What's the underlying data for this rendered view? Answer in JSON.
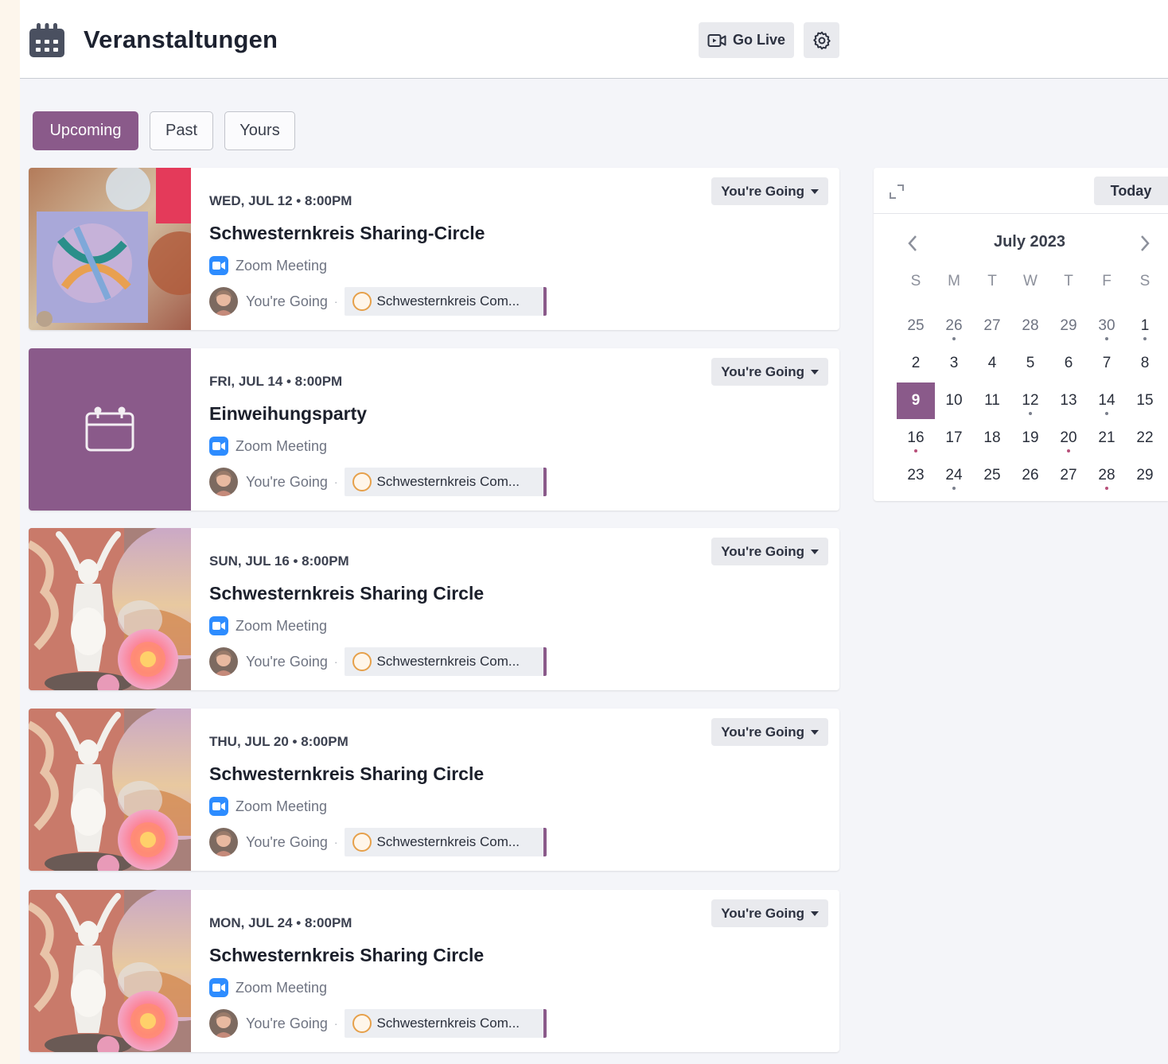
{
  "header": {
    "title": "Veranstaltungen",
    "go_live_label": "Go Live",
    "icons": {
      "page": "calendar-icon",
      "go_live": "video-icon",
      "settings": "gear-icon"
    }
  },
  "tabs": [
    {
      "label": "Upcoming",
      "active": true
    },
    {
      "label": "Past",
      "active": false
    },
    {
      "label": "Yours",
      "active": false
    }
  ],
  "events": [
    {
      "date": "WED, JUL 12 • 8:00PM",
      "title": "Schwesternkreis Sharing-Circle",
      "location": "Zoom Meeting",
      "attendance": "You're Going",
      "community": "Schwesternkreis Com...",
      "rsvp": "You're Going",
      "thumb": "painting-circle"
    },
    {
      "date": "FRI, JUL 14 • 8:00PM",
      "title": "Einweihungsparty",
      "location": "Zoom Meeting",
      "attendance": "You're Going",
      "community": "Schwesternkreis Com...",
      "rsvp": "You're Going",
      "thumb": "placeholder-calendar"
    },
    {
      "date": "SUN, JUL 16 • 8:00PM",
      "title": "Schwesternkreis Sharing Circle",
      "location": "Zoom Meeting",
      "attendance": "You're Going",
      "community": "Schwesternkreis Com...",
      "rsvp": "You're Going",
      "thumb": "goddess-rose"
    },
    {
      "date": "THU, JUL 20 • 8:00PM",
      "title": "Schwesternkreis Sharing Circle",
      "location": "Zoom Meeting",
      "attendance": "You're Going",
      "community": "Schwesternkreis Com...",
      "rsvp": "You're Going",
      "thumb": "goddess-rose"
    },
    {
      "date": "MON, JUL 24 • 8:00PM",
      "title": "Schwesternkreis Sharing Circle",
      "location": "Zoom Meeting",
      "attendance": "You're Going",
      "community": "Schwesternkreis Com...",
      "rsvp": "You're Going",
      "thumb": "goddess-rose"
    }
  ],
  "calendar": {
    "today_label": "Today",
    "month_label": "July 2023",
    "weekdays": [
      "S",
      "M",
      "T",
      "W",
      "T",
      "F",
      "S"
    ],
    "weeks": [
      [
        {
          "d": "25",
          "m": true
        },
        {
          "d": "26",
          "m": true,
          "dot": true
        },
        {
          "d": "27",
          "m": true
        },
        {
          "d": "28",
          "m": true
        },
        {
          "d": "29",
          "m": true
        },
        {
          "d": "30",
          "m": true,
          "dot": true
        },
        {
          "d": "1",
          "dot": true
        }
      ],
      [
        {
          "d": "2"
        },
        {
          "d": "3"
        },
        {
          "d": "4"
        },
        {
          "d": "5"
        },
        {
          "d": "6"
        },
        {
          "d": "7"
        },
        {
          "d": "8"
        }
      ],
      [
        {
          "d": "9",
          "sel": true
        },
        {
          "d": "10"
        },
        {
          "d": "11"
        },
        {
          "d": "12",
          "dot": true
        },
        {
          "d": "13"
        },
        {
          "d": "14",
          "dot": true
        },
        {
          "d": "15"
        }
      ],
      [
        {
          "d": "16",
          "dot": true,
          "pink": true
        },
        {
          "d": "17"
        },
        {
          "d": "18"
        },
        {
          "d": "19"
        },
        {
          "d": "20",
          "dot": true,
          "pink": true
        },
        {
          "d": "21"
        },
        {
          "d": "22"
        }
      ],
      [
        {
          "d": "23"
        },
        {
          "d": "24",
          "dot": true
        },
        {
          "d": "25"
        },
        {
          "d": "26"
        },
        {
          "d": "27"
        },
        {
          "d": "28",
          "dot": true,
          "pink": true
        },
        {
          "d": "29"
        }
      ]
    ]
  },
  "colors": {
    "accent": "#8a5a8a",
    "zoom": "#2d8cff",
    "page_bg": "#f4f5f9"
  }
}
